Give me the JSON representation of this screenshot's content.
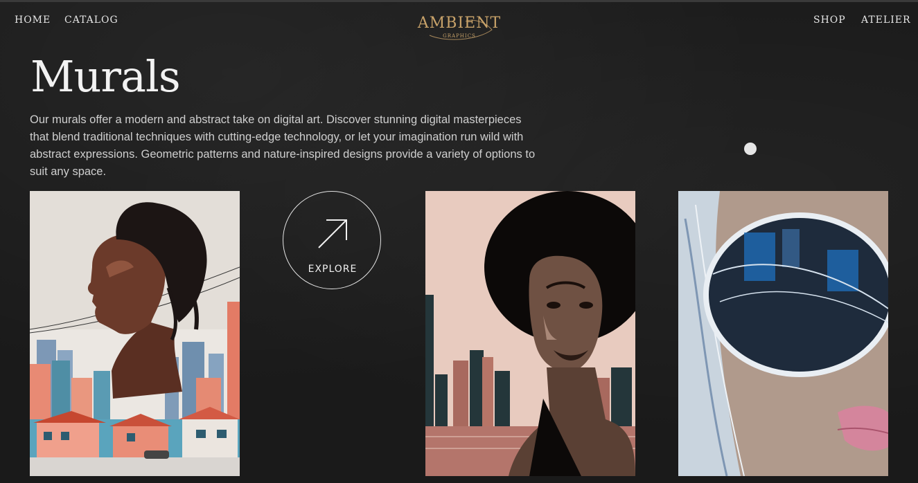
{
  "nav": {
    "home_label": "HOME",
    "catalog_label": "CATALOG",
    "shop_label": "SHOP",
    "atelier_label": "ATELIER"
  },
  "logo": {
    "main": "AMBIENT",
    "sub": "GRAPHICS"
  },
  "hero": {
    "title": "Murals",
    "description": "Our murals offer a modern and abstract take on digital art. Discover stunning digital masterpieces that blend traditional techniques with cutting-edge technology, or let your imagination run wild with abstract expressions. Geometric patterns and nature-inspired designs provide a variety of options to suit any space."
  },
  "explore": {
    "label": "EXPLORE",
    "icon": "arrow-up-right-icon"
  },
  "colors": {
    "background": "#1a1a1a",
    "logo_gold": "#c9a36a",
    "text": "#f2f2f2"
  }
}
